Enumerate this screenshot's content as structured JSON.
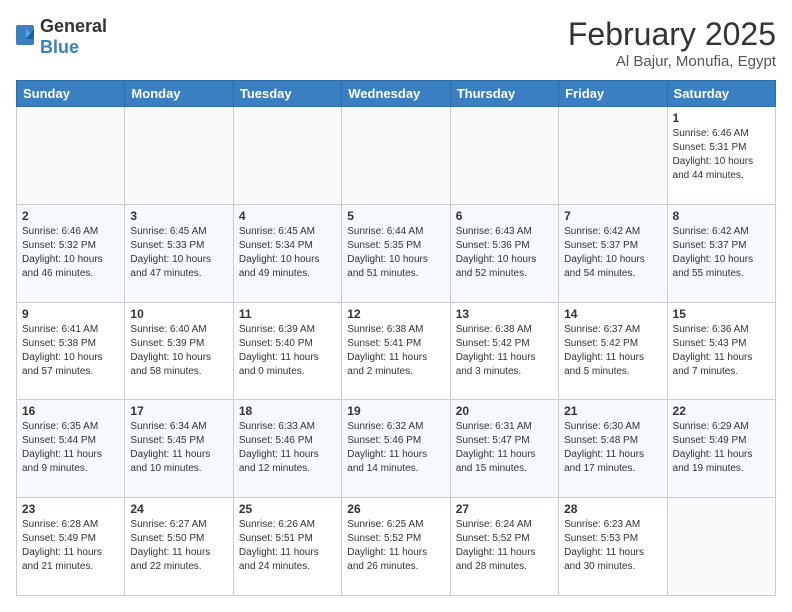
{
  "header": {
    "logo_general": "General",
    "logo_blue": "Blue",
    "month_title": "February 2025",
    "location": "Al Bajur, Monufia, Egypt"
  },
  "weekdays": [
    "Sunday",
    "Monday",
    "Tuesday",
    "Wednesday",
    "Thursday",
    "Friday",
    "Saturday"
  ],
  "weeks": [
    [
      {
        "day": "",
        "info": ""
      },
      {
        "day": "",
        "info": ""
      },
      {
        "day": "",
        "info": ""
      },
      {
        "day": "",
        "info": ""
      },
      {
        "day": "",
        "info": ""
      },
      {
        "day": "",
        "info": ""
      },
      {
        "day": "1",
        "info": "Sunrise: 6:46 AM\nSunset: 5:31 PM\nDaylight: 10 hours and 44 minutes."
      }
    ],
    [
      {
        "day": "2",
        "info": "Sunrise: 6:46 AM\nSunset: 5:32 PM\nDaylight: 10 hours and 46 minutes."
      },
      {
        "day": "3",
        "info": "Sunrise: 6:45 AM\nSunset: 5:33 PM\nDaylight: 10 hours and 47 minutes."
      },
      {
        "day": "4",
        "info": "Sunrise: 6:45 AM\nSunset: 5:34 PM\nDaylight: 10 hours and 49 minutes."
      },
      {
        "day": "5",
        "info": "Sunrise: 6:44 AM\nSunset: 5:35 PM\nDaylight: 10 hours and 51 minutes."
      },
      {
        "day": "6",
        "info": "Sunrise: 6:43 AM\nSunset: 5:36 PM\nDaylight: 10 hours and 52 minutes."
      },
      {
        "day": "7",
        "info": "Sunrise: 6:42 AM\nSunset: 5:37 PM\nDaylight: 10 hours and 54 minutes."
      },
      {
        "day": "8",
        "info": "Sunrise: 6:42 AM\nSunset: 5:37 PM\nDaylight: 10 hours and 55 minutes."
      }
    ],
    [
      {
        "day": "9",
        "info": "Sunrise: 6:41 AM\nSunset: 5:38 PM\nDaylight: 10 hours and 57 minutes."
      },
      {
        "day": "10",
        "info": "Sunrise: 6:40 AM\nSunset: 5:39 PM\nDaylight: 10 hours and 58 minutes."
      },
      {
        "day": "11",
        "info": "Sunrise: 6:39 AM\nSunset: 5:40 PM\nDaylight: 11 hours and 0 minutes."
      },
      {
        "day": "12",
        "info": "Sunrise: 6:38 AM\nSunset: 5:41 PM\nDaylight: 11 hours and 2 minutes."
      },
      {
        "day": "13",
        "info": "Sunrise: 6:38 AM\nSunset: 5:42 PM\nDaylight: 11 hours and 3 minutes."
      },
      {
        "day": "14",
        "info": "Sunrise: 6:37 AM\nSunset: 5:42 PM\nDaylight: 11 hours and 5 minutes."
      },
      {
        "day": "15",
        "info": "Sunrise: 6:36 AM\nSunset: 5:43 PM\nDaylight: 11 hours and 7 minutes."
      }
    ],
    [
      {
        "day": "16",
        "info": "Sunrise: 6:35 AM\nSunset: 5:44 PM\nDaylight: 11 hours and 9 minutes."
      },
      {
        "day": "17",
        "info": "Sunrise: 6:34 AM\nSunset: 5:45 PM\nDaylight: 11 hours and 10 minutes."
      },
      {
        "day": "18",
        "info": "Sunrise: 6:33 AM\nSunset: 5:46 PM\nDaylight: 11 hours and 12 minutes."
      },
      {
        "day": "19",
        "info": "Sunrise: 6:32 AM\nSunset: 5:46 PM\nDaylight: 11 hours and 14 minutes."
      },
      {
        "day": "20",
        "info": "Sunrise: 6:31 AM\nSunset: 5:47 PM\nDaylight: 11 hours and 15 minutes."
      },
      {
        "day": "21",
        "info": "Sunrise: 6:30 AM\nSunset: 5:48 PM\nDaylight: 11 hours and 17 minutes."
      },
      {
        "day": "22",
        "info": "Sunrise: 6:29 AM\nSunset: 5:49 PM\nDaylight: 11 hours and 19 minutes."
      }
    ],
    [
      {
        "day": "23",
        "info": "Sunrise: 6:28 AM\nSunset: 5:49 PM\nDaylight: 11 hours and 21 minutes."
      },
      {
        "day": "24",
        "info": "Sunrise: 6:27 AM\nSunset: 5:50 PM\nDaylight: 11 hours and 22 minutes."
      },
      {
        "day": "25",
        "info": "Sunrise: 6:26 AM\nSunset: 5:51 PM\nDaylight: 11 hours and 24 minutes."
      },
      {
        "day": "26",
        "info": "Sunrise: 6:25 AM\nSunset: 5:52 PM\nDaylight: 11 hours and 26 minutes."
      },
      {
        "day": "27",
        "info": "Sunrise: 6:24 AM\nSunset: 5:52 PM\nDaylight: 11 hours and 28 minutes."
      },
      {
        "day": "28",
        "info": "Sunrise: 6:23 AM\nSunset: 5:53 PM\nDaylight: 11 hours and 30 minutes."
      },
      {
        "day": "",
        "info": ""
      }
    ]
  ]
}
